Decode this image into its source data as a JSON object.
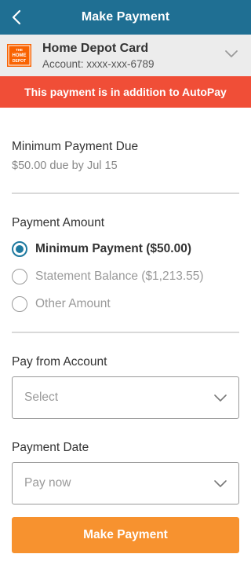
{
  "header": {
    "title": "Make Payment",
    "back_icon": "chevron-left-icon",
    "background": "#1f6f93"
  },
  "account": {
    "name": "Home Depot Card",
    "number": "Account: xxxx-xxx-6789",
    "logo_icon": "home-depot-logo",
    "logo_text": "THE HOME DEPOT",
    "chevron_icon": "chevron-down-icon"
  },
  "alert": {
    "text": "This payment is in addition to AutoPay",
    "color": "#f04e37"
  },
  "minimum_due": {
    "title": "Minimum Payment Due",
    "detail": "$50.00 due by Jul 15"
  },
  "payment_amount": {
    "title": "Payment Amount",
    "options": [
      {
        "label": "Minimum Payment ($50.00)",
        "selected": true
      },
      {
        "label": "Statement Balance ($1,213.55)",
        "selected": false
      },
      {
        "label": "Other Amount",
        "selected": false
      }
    ],
    "accent": "#1f7aa0"
  },
  "pay_from": {
    "title": "Pay from Account",
    "value": "Select"
  },
  "payment_date": {
    "title": "Payment Date",
    "value": "Pay now"
  },
  "submit": {
    "label": "Make Payment",
    "color": "#f7922f"
  }
}
